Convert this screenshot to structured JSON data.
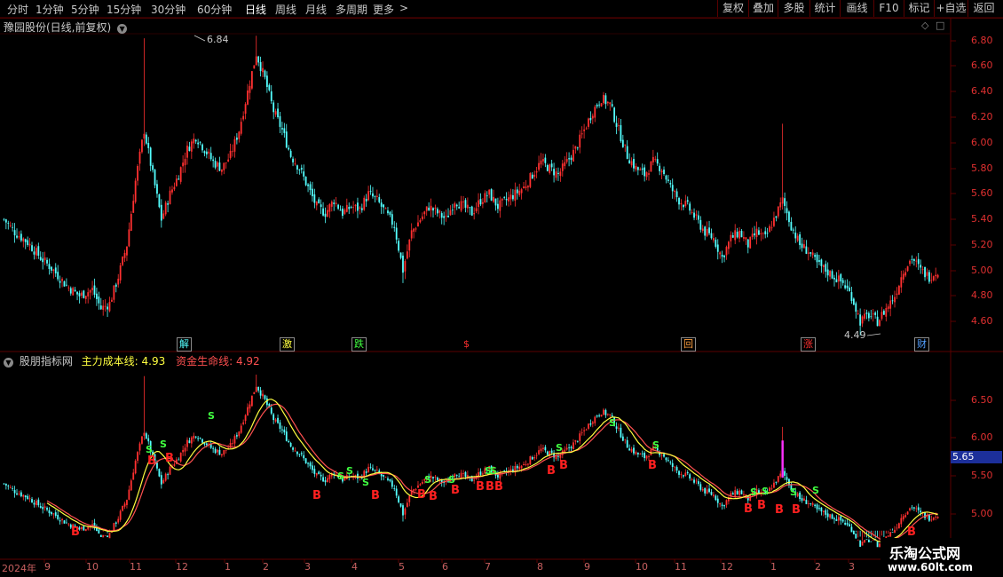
{
  "toolbar": {
    "periods": [
      "分时",
      "1分钟",
      "5分钟",
      "15分钟",
      "30分钟",
      "60分钟",
      "日线",
      "周线",
      "月线",
      "多周期",
      "更多"
    ],
    "more_arrow": ">",
    "buttons": [
      "复权",
      "叠加",
      "多股",
      "统计",
      "画线",
      "F10",
      "标记",
      "+自选",
      "返回"
    ]
  },
  "main_panel": {
    "title": "豫园股份(日线,前复权)",
    "high_label": "6.84",
    "low_label": "4.49",
    "y_ticks": [
      "6.80",
      "6.60",
      "6.40",
      "6.20",
      "6.00",
      "5.80",
      "5.60",
      "5.40",
      "5.20",
      "5.00",
      "4.80",
      "4.60"
    ],
    "signals": [
      "解",
      "激",
      "跌",
      "$",
      "回",
      "涨",
      "财"
    ]
  },
  "indicator_panel": {
    "title": "股朋指标网",
    "line1_name": "主力成本线:",
    "line1_value": "4.93",
    "line2_name": "资金生命线:",
    "line2_value": "4.92",
    "y_ticks": [
      "6.50",
      "6.00",
      "5.50",
      "5.00"
    ],
    "current_value": "5.65",
    "b_label": "B",
    "s_label": "S"
  },
  "x_axis": {
    "year_label": "2024年",
    "months": [
      "9",
      "10",
      "11",
      "12",
      "1",
      "2",
      "3",
      "4",
      "5",
      "6",
      "7",
      "8",
      "9",
      "10",
      "11",
      "12",
      "1",
      "2",
      "3"
    ]
  },
  "watermark": {
    "name": "乐淘公式网",
    "url": "www.60lt.com"
  },
  "colors": {
    "up": "#ff3030",
    "down": "#54ffff",
    "cost_line": "#ffff40",
    "life_line": "#ff5050",
    "grid_line": "#5a0000"
  },
  "chart_data": {
    "type": "candlestick",
    "x_range": [
      "2024-08",
      "2025-03"
    ],
    "ylim_main": [
      4.45,
      6.95
    ],
    "ylim_indicator": [
      4.75,
      6.95
    ],
    "close_series": [
      [
        1,
        5.4
      ],
      [
        6,
        5.3
      ],
      [
        12,
        5.22
      ],
      [
        18,
        5.1
      ],
      [
        24,
        5.0
      ],
      [
        30,
        4.88
      ],
      [
        36,
        4.8
      ],
      [
        42,
        4.85
      ],
      [
        46,
        4.7
      ],
      [
        50,
        4.74
      ],
      [
        54,
        4.95
      ],
      [
        58,
        5.2
      ],
      [
        62,
        5.7
      ],
      [
        66,
        6.1
      ],
      [
        70,
        5.75
      ],
      [
        74,
        5.4
      ],
      [
        78,
        5.6
      ],
      [
        82,
        5.75
      ],
      [
        86,
        5.95
      ],
      [
        90,
        6.05
      ],
      [
        94,
        5.95
      ],
      [
        98,
        5.85
      ],
      [
        102,
        5.8
      ],
      [
        106,
        5.9
      ],
      [
        110,
        6.1
      ],
      [
        114,
        6.4
      ],
      [
        118,
        6.7
      ],
      [
        122,
        6.5
      ],
      [
        126,
        6.25
      ],
      [
        130,
        6.1
      ],
      [
        134,
        5.9
      ],
      [
        138,
        5.8
      ],
      [
        142,
        5.65
      ],
      [
        146,
        5.5
      ],
      [
        150,
        5.45
      ],
      [
        154,
        5.55
      ],
      [
        158,
        5.45
      ],
      [
        162,
        5.5
      ],
      [
        166,
        5.48
      ],
      [
        170,
        5.6
      ],
      [
        174,
        5.55
      ],
      [
        178,
        5.45
      ],
      [
        182,
        5.35
      ],
      [
        186,
        5.0
      ],
      [
        190,
        5.3
      ],
      [
        194,
        5.4
      ],
      [
        198,
        5.5
      ],
      [
        202,
        5.45
      ],
      [
        206,
        5.4
      ],
      [
        210,
        5.55
      ],
      [
        214,
        5.5
      ],
      [
        218,
        5.45
      ],
      [
        222,
        5.55
      ],
      [
        226,
        5.6
      ],
      [
        230,
        5.5
      ],
      [
        234,
        5.55
      ],
      [
        238,
        5.6
      ],
      [
        242,
        5.65
      ],
      [
        246,
        5.75
      ],
      [
        250,
        5.85
      ],
      [
        254,
        5.8
      ],
      [
        258,
        5.75
      ],
      [
        262,
        5.85
      ],
      [
        266,
        5.95
      ],
      [
        270,
        6.1
      ],
      [
        274,
        6.25
      ],
      [
        278,
        6.35
      ],
      [
        282,
        6.3
      ],
      [
        286,
        6.1
      ],
      [
        290,
        5.9
      ],
      [
        294,
        5.8
      ],
      [
        298,
        5.75
      ],
      [
        302,
        5.85
      ],
      [
        306,
        5.8
      ],
      [
        310,
        5.65
      ],
      [
        314,
        5.55
      ],
      [
        318,
        5.5
      ],
      [
        322,
        5.4
      ],
      [
        326,
        5.3
      ],
      [
        330,
        5.25
      ],
      [
        334,
        5.1
      ],
      [
        338,
        5.25
      ],
      [
        342,
        5.3
      ],
      [
        346,
        5.2
      ],
      [
        350,
        5.3
      ],
      [
        354,
        5.25
      ],
      [
        358,
        5.4
      ],
      [
        362,
        5.55
      ],
      [
        366,
        5.35
      ],
      [
        370,
        5.2
      ],
      [
        374,
        5.15
      ],
      [
        378,
        5.05
      ],
      [
        382,
        5.0
      ],
      [
        386,
        4.95
      ],
      [
        390,
        4.9
      ],
      [
        394,
        4.8
      ],
      [
        398,
        4.6
      ],
      [
        402,
        4.65
      ],
      [
        406,
        4.6
      ],
      [
        410,
        4.7
      ],
      [
        414,
        4.8
      ],
      [
        418,
        5.0
      ],
      [
        422,
        5.1
      ],
      [
        426,
        5.0
      ],
      [
        430,
        4.95
      ],
      [
        434,
        5.0
      ]
    ]
  }
}
